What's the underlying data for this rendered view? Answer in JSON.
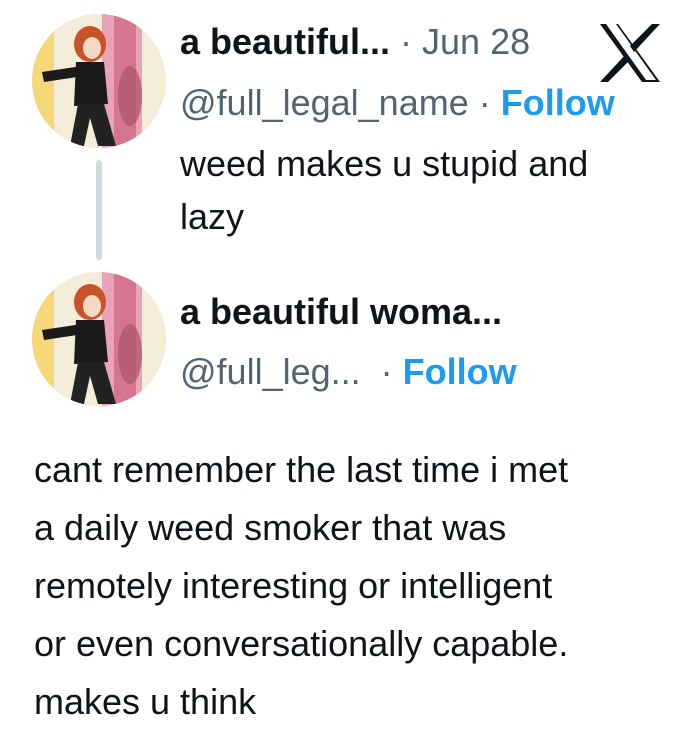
{
  "tweet1": {
    "display_name": "a beautiful...",
    "separator": " · ",
    "date": "Jun 28",
    "handle": "@full_legal_name",
    "follow_sep": " · ",
    "follow_label": "Follow",
    "text_line1": "weed makes u stupid and",
    "text_line2": "lazy"
  },
  "tweet2": {
    "display_name": "a beautiful woma...",
    "handle": "@full_leg...",
    "follow_sep": "  · ",
    "follow_label": "Follow",
    "text_lines": [
      "cant remember the last time i met",
      "a daily weed smoker that was",
      "remotely interesting or intelligent",
      "or even conversationally capable.",
      "makes u think"
    ]
  },
  "icons": {
    "platform_logo": "x-logo",
    "avatar": "avatar-illustration"
  },
  "colors": {
    "text": "#0f1419",
    "muted": "#536471",
    "follow": "#1d9bf0",
    "thread_line": "#cfd9de"
  }
}
